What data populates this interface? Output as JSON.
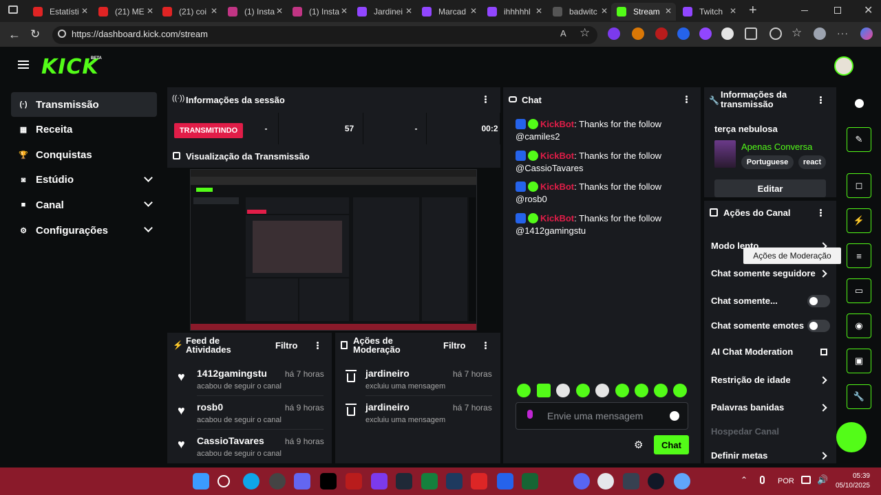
{
  "browser": {
    "tabs": [
      {
        "title": "Estatísti",
        "color": "#e02424"
      },
      {
        "title": "(21) ME",
        "color": "#e02424"
      },
      {
        "title": "(21) coi",
        "color": "#e02424"
      },
      {
        "title": "(1) Insta",
        "color": "#c13584"
      },
      {
        "title": "(1) Insta",
        "color": "#c13584"
      },
      {
        "title": "Jardinei",
        "color": "#9146ff"
      },
      {
        "title": "Marcad",
        "color": "#9146ff"
      },
      {
        "title": "ihhhhhl",
        "color": "#9146ff"
      },
      {
        "title": "badwitc",
        "color": "#555555"
      },
      {
        "title": "Stream",
        "color": "#53fc18"
      },
      {
        "title": "Twitch",
        "color": "#9146ff"
      }
    ],
    "url": "https://dashboard.kick.com/stream",
    "new_tab": "+"
  },
  "brand": {
    "logo": "KICK",
    "beta": "BETA",
    "accent": "#53fc18"
  },
  "sidebar": {
    "items": [
      {
        "label": "Transmissão",
        "icon": "broadcast-icon"
      },
      {
        "label": "Receita",
        "icon": "revenue-icon"
      },
      {
        "label": "Conquistas",
        "icon": "trophy-icon"
      },
      {
        "label": "Estúdio",
        "icon": "studio-icon"
      },
      {
        "label": "Canal",
        "icon": "channel-icon"
      },
      {
        "label": "Configurações",
        "icon": "gear-icon"
      }
    ]
  },
  "session": {
    "title": "Informações da sessão",
    "status": "TRANSMITINDO",
    "stats": [
      "-",
      "57",
      "-",
      "00:2"
    ]
  },
  "preview": {
    "title": "Visualização da Transmissão"
  },
  "feed": {
    "title": "Feed de Atividades",
    "filter": "Filtro",
    "items": [
      {
        "user": "1412gamingstu",
        "time": "há 7 horas",
        "action": "acabou de seguir o canal"
      },
      {
        "user": "rosb0",
        "time": "há 9 horas",
        "action": "acabou de seguir o canal"
      },
      {
        "user": "CassioTavares",
        "time": "há 9 horas",
        "action": "acabou de seguir o canal"
      }
    ]
  },
  "moderation": {
    "title": "Ações de Moderação",
    "filter": "Filtro",
    "items": [
      {
        "user": "jardineiro",
        "time": "há 7 horas",
        "action": "excluiu uma mensagem"
      },
      {
        "user": "jardineiro",
        "time": "há 7 horas",
        "action": "excluiu uma mensagem"
      }
    ]
  },
  "chat": {
    "title": "Chat",
    "messages": [
      {
        "bot": "KickBot",
        "text": ": Thanks for the follow",
        "user": "@camiles2"
      },
      {
        "bot": "KickBot",
        "text": ": Thanks for the follow",
        "user": "@CassioTavares"
      },
      {
        "bot": "KickBot",
        "text": ": Thanks for the follow",
        "user": "@rosb0"
      },
      {
        "bot": "KickBot",
        "text": ": Thanks for the follow",
        "user": "@1412gamingstu"
      }
    ],
    "placeholder": "Envie uma mensagem",
    "send": "Chat"
  },
  "stream_info": {
    "title": "Informações da transmissão",
    "stream_title": "terça nebulosa",
    "category": "Apenas Conversa",
    "tags": [
      "Portuguese",
      "react"
    ],
    "edit": "Editar"
  },
  "channel_actions": {
    "title": "Ações do Canal",
    "items": [
      {
        "label": "Modo lento",
        "kind": "chevron"
      },
      {
        "label": "Chat somente seguidore",
        "kind": "chevron"
      },
      {
        "label": "Chat somente...",
        "kind": "toggle"
      },
      {
        "label": "Chat somente emotes",
        "kind": "toggle"
      },
      {
        "label": "AI Chat Moderation",
        "kind": "external"
      },
      {
        "label": "Restrição de idade",
        "kind": "chevron"
      },
      {
        "label": "Palavras banidas",
        "kind": "chevron"
      },
      {
        "label": "Hospedar Canal",
        "kind": "disabled"
      },
      {
        "label": "Definir metas",
        "kind": "chevron"
      }
    ],
    "tooltip": "Ações de Moderação"
  },
  "taskbar": {
    "lang": "POR",
    "time": "05:39",
    "date": "05/10/2025"
  }
}
